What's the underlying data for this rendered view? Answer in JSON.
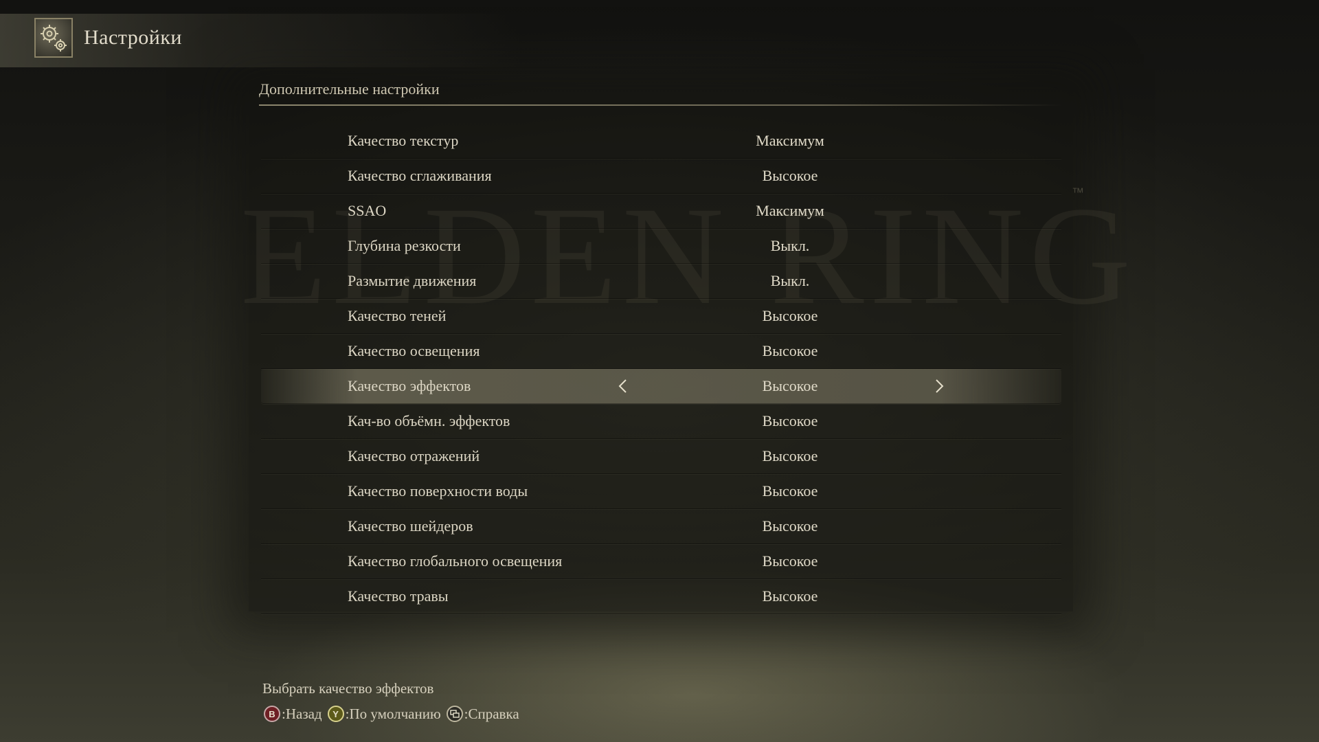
{
  "header": {
    "title": "Настройки",
    "icon": "gears-icon"
  },
  "section": {
    "title": "Дополнительные настройки"
  },
  "watermark": {
    "text": "ELDEN RING",
    "tm": "™"
  },
  "settings": [
    {
      "label": "Качество текстур",
      "value": "Максимум"
    },
    {
      "label": "Качество сглаживания",
      "value": "Высокое"
    },
    {
      "label": "SSAO",
      "value": "Максимум"
    },
    {
      "label": "Глубина резкости",
      "value": "Выкл."
    },
    {
      "label": "Размытие движения",
      "value": "Выкл."
    },
    {
      "label": "Качество теней",
      "value": "Высокое"
    },
    {
      "label": "Качество освещения",
      "value": "Высокое"
    },
    {
      "label": "Качество эффектов",
      "value": "Высокое"
    },
    {
      "label": "Кач-во объёмн. эффектов",
      "value": "Высокое"
    },
    {
      "label": "Качество отражений",
      "value": "Высокое"
    },
    {
      "label": "Качество поверхности воды",
      "value": "Высокое"
    },
    {
      "label": "Качество шейдеров",
      "value": "Высокое"
    },
    {
      "label": "Качество глобального освещения",
      "value": "Высокое"
    },
    {
      "label": "Качество травы",
      "value": "Высокое"
    }
  ],
  "selected_index": 7,
  "footer": {
    "description": "Выбрать качество эффектов",
    "hints": [
      {
        "button": "B",
        "icon": "b-button-icon",
        "label": ":Назад"
      },
      {
        "button": "Y",
        "icon": "y-button-icon",
        "label": ":По умолчанию"
      },
      {
        "button": "",
        "icon": "view-button-icon",
        "label": ":Справка"
      }
    ]
  },
  "colors": {
    "text": "#d9d4c4",
    "selected_row": "#78745f",
    "b_button": "#6e1f24",
    "y_button": "#5c5a1a"
  }
}
